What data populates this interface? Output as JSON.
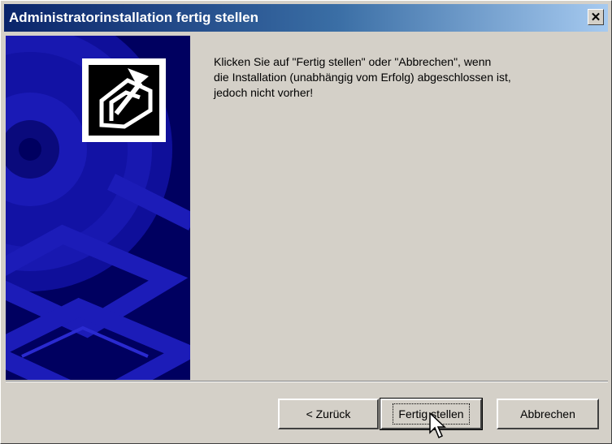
{
  "window": {
    "title": "Administratorinstallation fertig stellen",
    "close_glyph": "✕"
  },
  "message": {
    "lines": [
      "Klicken Sie auf \"Fertig stellen\" oder \"Abbrechen\", wenn",
      "die Installation (unabhängig vom Erfolg) abgeschlossen ist,",
      "jedoch nicht vorher!"
    ]
  },
  "buttons": {
    "back": "< Zurück",
    "finish": "Fertig stellen",
    "cancel": "Abbrechen"
  },
  "icons": {
    "side_graphic": "installer-cd-graphic",
    "setup_logo": "setup-arrow-icon",
    "cursor": "mouse-pointer-icon"
  },
  "colors": {
    "titlebar_start": "#0a246a",
    "titlebar_end": "#a6caf0",
    "panel_bg": "#000060",
    "panel_accent": "#1c1cb8",
    "dialog_bg": "#d4d0c8"
  }
}
